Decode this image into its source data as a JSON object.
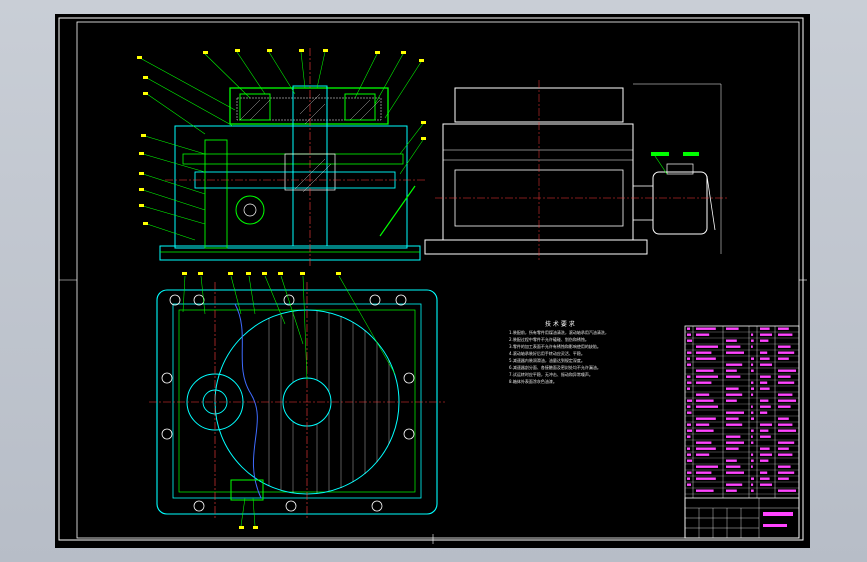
{
  "drawing": {
    "tech_notes": {
      "title": "技 术 要 求",
      "lines": [
        "1.装配前，所有零件用煤油清洗，滚动轴承用汽油清洗，",
        "2.装配过程中零件不允许磕碰、划伤和锈蚀。",
        "3.零件的加工表面不允许有锈蚀和影响使用的缺陷。",
        "4.滚动轴承装好后用手转动应灵活、平稳。",
        "5.减速器内装润滑油，油量达到规定深度。",
        "6.减速器剖分面、各接触面及密封处均不允许漏油。",
        "7.试运转时应平稳，无冲击、振动和异常噪声。",
        "8.箱体外表面涂灰色油漆。"
      ]
    },
    "colors": {
      "background": "#000000",
      "frame": "#ffffff",
      "outline": "#00ff00",
      "body": "#00ffff",
      "centerline": "#ff3b3b",
      "hidden": "#3f6bff",
      "dim": "#ffff00",
      "leader": "#00ff00",
      "hatch": "#ffffff",
      "table": "#ff44ff"
    }
  }
}
